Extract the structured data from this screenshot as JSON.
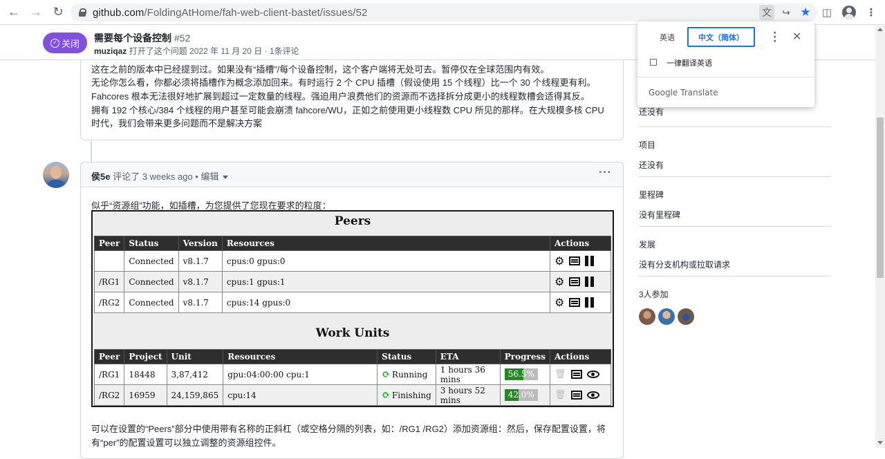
{
  "browser": {
    "url_host": "github.com",
    "url_path": "/FoldingAtHome/fah-web-client-bastet/issues/52"
  },
  "issue": {
    "state_label": "关闭",
    "title": "需要每个设备控制",
    "number": "#52",
    "author": "muziqaz",
    "meta": "打开了这个问题 2022 年 11 月 20 日 · 1条评论"
  },
  "first_comment": {
    "lines": [
      "这在之前的版本中已经提到过。如果没有“插槽”/每个设备控制，这个客户端将无处可去。暂停仅在全球范围内有效。",
      "无论你怎么看，你都必须将插槽作为概念添加回来。有时运行 2 个 CPU 插槽（假设使用 15 个线程）比一个 30 个线程更有利。",
      "Fahcores 根本无法很好地扩展到超过一定数量的线程。强迫用户浪费他们的资源而不选择拆分成更小的线程数槽会适得其反。",
      "拥有 192 个核心/384 个线程的用户甚至可能会崩溃 fahcore/WU，正如之前使用更小线程数 CPU 所见的那样。在大规模多核 CPU",
      "时代，我们会带来更多问题而不是解决方案"
    ]
  },
  "second_comment": {
    "author": "侯5e",
    "meta": "评论了 3 weeks ago • 编辑",
    "intro": "似乎“资源组”功能，如插槽，为您提供了您现在要求的粒度：",
    "outro": "可以在设置的“Peers”部分中使用带有名称的正斜杠（或空格分隔的列表，如：/RG1 /RG2）添加资源组：然后，保存配置设置，将有“per”的配置设置可以独立调整的资源组控件。"
  },
  "fah": {
    "peers_title": "Peers",
    "peers_headers": [
      "Peer",
      "Status",
      "Version",
      "Resources",
      "Actions"
    ],
    "peers_rows": [
      {
        "peer": "",
        "status": "Connected",
        "version": "v8.1.7",
        "resources": "cpus:0 gpus:0"
      },
      {
        "peer": "/RG1",
        "status": "Connected",
        "version": "v8.1.7",
        "resources": "cpus:1 gpus:1"
      },
      {
        "peer": "/RG2",
        "status": "Connected",
        "version": "v8.1.7",
        "resources": "cpus:14 gpus:0"
      }
    ],
    "wu_title": "Work Units",
    "wu_headers": [
      "Peer",
      "Project",
      "Unit",
      "Resources",
      "Status",
      "ETA",
      "Progress",
      "Actions"
    ],
    "wu_rows": [
      {
        "peer": "/RG1",
        "project": "18448",
        "unit": "3,87,412",
        "resources": "gpu:04:00:00 cpu:1",
        "status": "Running",
        "eta": "1 hours 36 mins",
        "progress_label": "56.5%",
        "progress": 56.5
      },
      {
        "peer": "/RG2",
        "project": "16959",
        "unit": "24,159,865",
        "resources": "cpu:14",
        "status": "Finishing",
        "eta": "3 hours 52 mins",
        "progress_label": "42.0%",
        "progress": 42.0
      }
    ]
  },
  "sidebar": {
    "first_value": "还没有",
    "projects_label": "项目",
    "projects_value": "还没有",
    "milestone_label": "里程碑",
    "milestone_value": "没有里程碑",
    "development_label": "发展",
    "development_value": "没有分支机构或拉取请求",
    "participants_label": "3人参加"
  },
  "translate_popup": {
    "tab_source": "英语",
    "tab_target": "中文（简体）",
    "always_translate": "一律翻译英语",
    "brand": "Google Translate"
  },
  "colors": {
    "closed": "#8250df",
    "connected": "#1aaa1a",
    "project": "#f08030",
    "progress_fill": "#1f8c1f",
    "accent": "#1a73e8"
  }
}
